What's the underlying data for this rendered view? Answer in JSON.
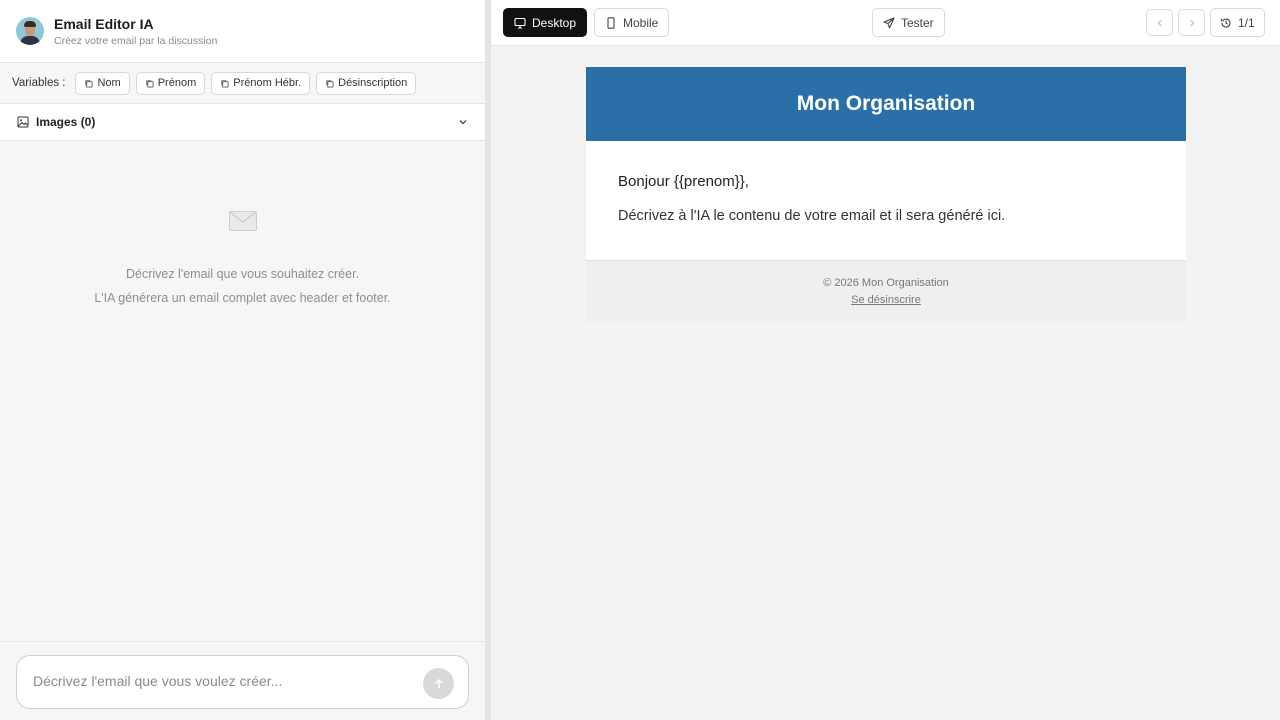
{
  "app": {
    "title": "Email Editor IA",
    "subtitle": "Créez votre email par la discussion"
  },
  "variables": {
    "label": "Variables :",
    "chips": [
      "Nom",
      "Prénom",
      "Prénom Hébr.",
      "Désinscription"
    ]
  },
  "images": {
    "label": "Images (0)"
  },
  "empty_state": {
    "line1": "Décrivez l'email que vous souhaitez créer.",
    "line2": "L'IA générera un email complet avec header et footer."
  },
  "composer": {
    "placeholder": "Décrivez l'email que vous voulez créer..."
  },
  "toolbar": {
    "desktop_label": "Desktop",
    "mobile_label": "Mobile",
    "test_label": "Tester",
    "version": "1/1",
    "active_view": "Desktop"
  },
  "email": {
    "header_title": "Mon Organisation",
    "header_color": "#2b6fa8",
    "greeting": "Bonjour {{prenom}},",
    "body": "Décrivez à l'IA le contenu de votre email et il sera généré ici.",
    "footer_copyright": "© 2026 Mon Organisation",
    "unsubscribe": "Se désinscrire"
  }
}
